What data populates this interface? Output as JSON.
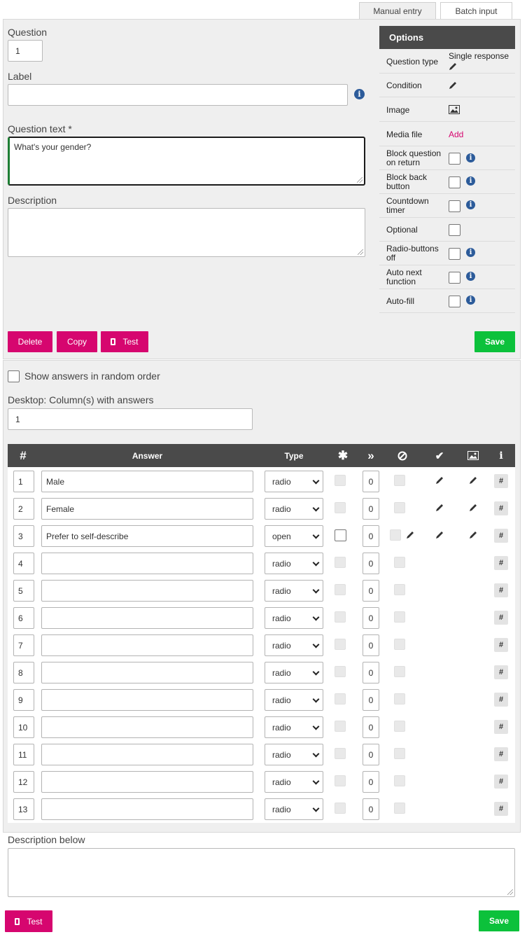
{
  "tabs": [
    {
      "label": "Manual entry",
      "active": true
    },
    {
      "label": "Batch input",
      "active": false
    }
  ],
  "form": {
    "question_label": "Question",
    "question_value": "1",
    "label_label": "Label",
    "label_value": "",
    "question_text_label": "Question text *",
    "question_text_value": "What's your gender?",
    "description_label": "Description",
    "description_value": ""
  },
  "options": {
    "title": "Options",
    "rows": [
      {
        "label": "Question type",
        "value": "Single response",
        "icon": "pencil-icon"
      },
      {
        "label": "Condition",
        "icon": "pencil-icon"
      },
      {
        "label": "Image",
        "icon": "image-icon"
      },
      {
        "label": "Media file",
        "value": "Add"
      },
      {
        "label": "Block question on return",
        "checkbox": false,
        "info": true
      },
      {
        "label": "Block back button",
        "checkbox": false,
        "info": true
      },
      {
        "label": "Countdown timer",
        "checkbox": false,
        "info": true
      },
      {
        "label": "Optional",
        "checkbox": false,
        "info": false
      },
      {
        "label": "Radio-buttons off",
        "checkbox": false,
        "info": true
      },
      {
        "label": "Auto next function",
        "checkbox": false,
        "info": true
      },
      {
        "label": "Auto-fill",
        "checkbox": false,
        "info": true
      }
    ]
  },
  "actions": {
    "delete": "Delete",
    "copy": "Copy",
    "test": "Test",
    "save": "Save"
  },
  "answers_settings": {
    "random_order_label": "Show answers in random order",
    "columns_label": "Desktop: Column(s) with answers",
    "columns_value": "1"
  },
  "table": {
    "headers": {
      "num": "#",
      "answer": "Answer",
      "type": "Type",
      "info": "i"
    },
    "rows": [
      {
        "num": "1",
        "answer": "Male",
        "type": "radio",
        "jump": "0",
        "edit": true
      },
      {
        "num": "2",
        "answer": "Female",
        "type": "radio",
        "jump": "0",
        "edit": true
      },
      {
        "num": "3",
        "answer": "Prefer to self-describe",
        "type": "open",
        "jump": "0",
        "edit": true
      },
      {
        "num": "4",
        "answer": "",
        "type": "radio",
        "jump": "0",
        "edit": false
      },
      {
        "num": "5",
        "answer": "",
        "type": "radio",
        "jump": "0",
        "edit": false
      },
      {
        "num": "6",
        "answer": "",
        "type": "radio",
        "jump": "0",
        "edit": false
      },
      {
        "num": "7",
        "answer": "",
        "type": "radio",
        "jump": "0",
        "edit": false
      },
      {
        "num": "8",
        "answer": "",
        "type": "radio",
        "jump": "0",
        "edit": false
      },
      {
        "num": "9",
        "answer": "",
        "type": "radio",
        "jump": "0",
        "edit": false
      },
      {
        "num": "10",
        "answer": "",
        "type": "radio",
        "jump": "0",
        "edit": false
      },
      {
        "num": "11",
        "answer": "",
        "type": "radio",
        "jump": "0",
        "edit": false
      },
      {
        "num": "12",
        "answer": "",
        "type": "radio",
        "jump": "0",
        "edit": false
      },
      {
        "num": "13",
        "answer": "",
        "type": "radio",
        "jump": "0",
        "edit": false
      }
    ],
    "hash_label": "#"
  },
  "description_below": {
    "label": "Description below",
    "value": ""
  },
  "bottom": {
    "test": "Test",
    "save": "Save"
  },
  "colors": {
    "accent_pink": "#d6066f",
    "save_green": "#0cc13b",
    "header_dark": "#4a4a4a",
    "info_blue": "#2c5b9a"
  }
}
